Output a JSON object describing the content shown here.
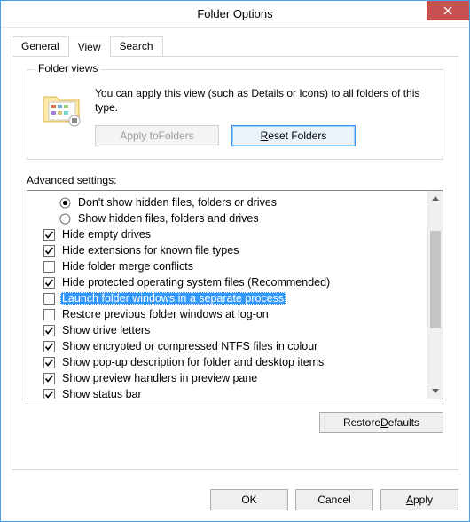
{
  "window": {
    "title": "Folder Options"
  },
  "tabs": {
    "general": "General",
    "view": "View",
    "search": "Search",
    "active": "view"
  },
  "folder_views": {
    "legend": "Folder views",
    "description": "You can apply this view (such as Details or Icons) to all folders of this type.",
    "apply_label": "Apply to Folders",
    "apply_underline_index": 8,
    "reset_label": "Reset Folders",
    "reset_underline_index": 0
  },
  "advanced": {
    "label": "Advanced settings:",
    "items": [
      {
        "type": "radio",
        "checked": true,
        "label": "Don't show hidden files, folders or drives",
        "selected": false
      },
      {
        "type": "radio",
        "checked": false,
        "label": "Show hidden files, folders and drives",
        "selected": false
      },
      {
        "type": "checkbox",
        "checked": true,
        "label": "Hide empty drives",
        "selected": false
      },
      {
        "type": "checkbox",
        "checked": true,
        "label": "Hide extensions for known file types",
        "selected": false
      },
      {
        "type": "checkbox",
        "checked": false,
        "label": "Hide folder merge conflicts",
        "selected": false
      },
      {
        "type": "checkbox",
        "checked": true,
        "label": "Hide protected operating system files (Recommended)",
        "selected": false
      },
      {
        "type": "checkbox",
        "checked": false,
        "label": "Launch folder windows in a separate process",
        "selected": true
      },
      {
        "type": "checkbox",
        "checked": false,
        "label": "Restore previous folder windows at log-on",
        "selected": false
      },
      {
        "type": "checkbox",
        "checked": true,
        "label": "Show drive letters",
        "selected": false
      },
      {
        "type": "checkbox",
        "checked": true,
        "label": "Show encrypted or compressed NTFS files in colour",
        "selected": false
      },
      {
        "type": "checkbox",
        "checked": true,
        "label": "Show pop-up description for folder and desktop items",
        "selected": false
      },
      {
        "type": "checkbox",
        "checked": true,
        "label": "Show preview handlers in preview pane",
        "selected": false
      },
      {
        "type": "checkbox",
        "checked": true,
        "label": "Show status bar",
        "selected": false
      }
    ]
  },
  "restore_defaults": {
    "label": "Restore Defaults",
    "underline_index": 8
  },
  "buttons": {
    "ok": "OK",
    "cancel": "Cancel",
    "apply": "Apply",
    "apply_underline_index": 0
  }
}
